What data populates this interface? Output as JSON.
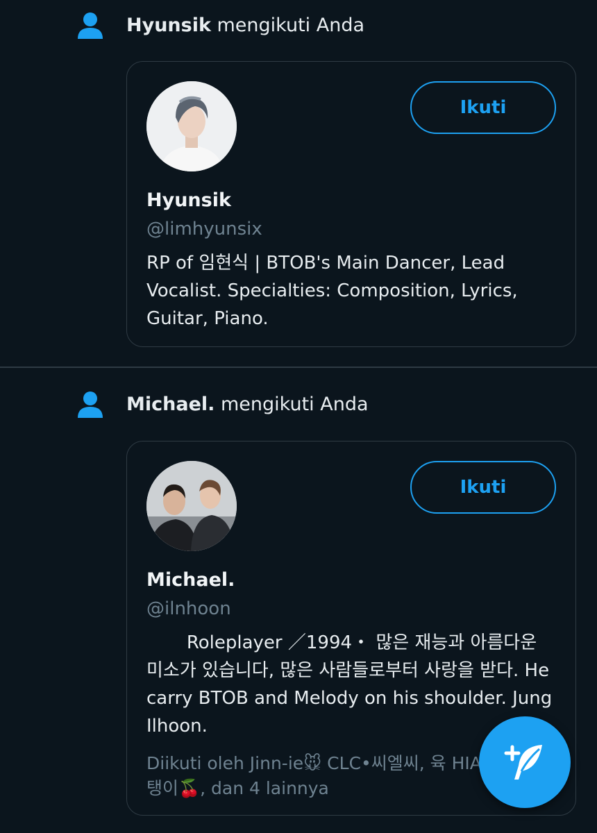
{
  "notifications": [
    {
      "actor_name": "Hyunsik",
      "action_text": " mengikuti Anda",
      "profile": {
        "name": "Hyunsik",
        "handle": "@limhyunsix",
        "bio": "RP of 임현식 | BTOB's Main Dancer, Lead Vocalist. Specialties: Composition, Lyrics, Guitar, Piano.",
        "follow_label": "Ikuti"
      }
    },
    {
      "actor_name": "Michael.",
      "action_text": " mengikuti Anda",
      "profile": {
        "name": "Michael.",
        "handle": "@ilnhoon",
        "bio": "       Roleplayer ／1994・ 많은 재능과 아름다운 미소가 있습니다, 많은 사람들로부터 사랑을 받다. He carry BTOB and Melody on his shoulder. Jung Ilhoon.",
        "follow_label": "Ikuti",
        "followed_by": "Diikuti oleh Jinn-ie🐭 CLC•씨엘씨, 육 HIATUS., 서탱이🍒, dan 4 lainnya"
      }
    }
  ],
  "icons": {
    "notification_type": "person-icon",
    "fab": "compose-tweet-icon"
  },
  "colors": {
    "background": "#0b151d",
    "accent": "#1da1f2",
    "secondary_text": "#6f8391",
    "border": "#2f3b44"
  }
}
